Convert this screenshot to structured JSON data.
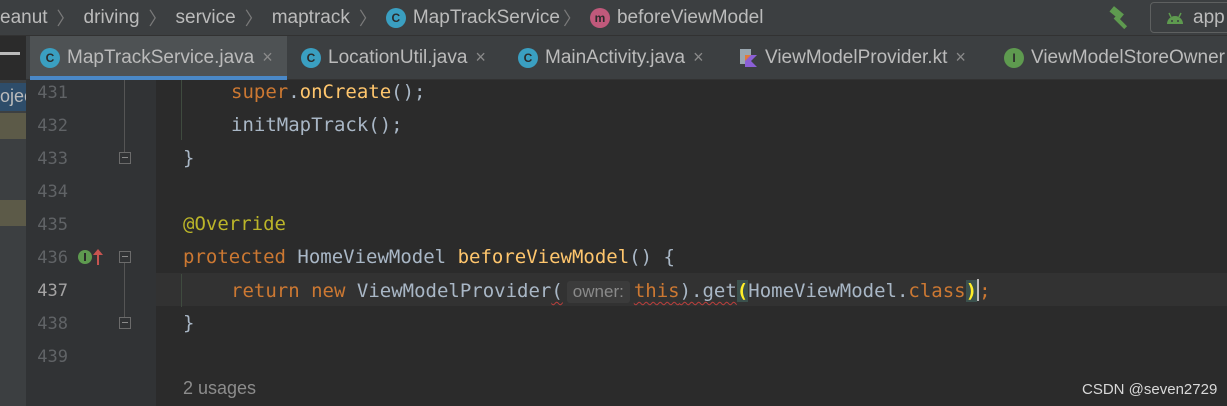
{
  "breadcrumb": {
    "items": [
      "eanut",
      "driving",
      "service",
      "maptrack"
    ],
    "class_item": {
      "icon_letter": "C",
      "label": "MapTrackService"
    },
    "method_item": {
      "icon_letter": "m",
      "label": "beforeViewModel"
    }
  },
  "run_config": {
    "label": "app"
  },
  "tabs": [
    {
      "label": "MapTrackService.java",
      "icon": "class-icon",
      "active": true,
      "closable": true
    },
    {
      "label": "LocationUtil.java",
      "icon": "class-icon",
      "active": false,
      "closable": true
    },
    {
      "label": "MainActivity.java",
      "icon": "class-icon",
      "active": false,
      "closable": true
    },
    {
      "label": "ViewModelProvider.kt",
      "icon": "kotlin-file-icon",
      "active": false,
      "closable": true
    },
    {
      "label": "ViewModelStoreOwner",
      "icon": "interface-icon",
      "active": false,
      "closable": false
    }
  ],
  "icon_letters": {
    "class": "C",
    "interface": "I"
  },
  "close_glyph": "×",
  "project_label": "ojec",
  "editor": {
    "line_numbers": [
      "431",
      "432",
      "433",
      "434",
      "435",
      "436",
      "437",
      "438",
      "439"
    ],
    "current_line": "437",
    "code": {
      "l431": {
        "a": "super",
        "b": ".",
        "c": "onCreate",
        "d": "();"
      },
      "l432": {
        "a": "initMapTrack",
        "b": "();"
      },
      "l433": "}",
      "l435": "@Override",
      "l436": {
        "kw": "protected",
        "type": "HomeViewModel",
        "name": "beforeViewModel",
        "rest": "() {"
      },
      "l437": {
        "kw1": "return",
        "kw2": "new",
        "cls": "ViewModelProvider",
        "open": "(",
        "hint": "owner:",
        "this": "this",
        "mid": ").get",
        "p": "(",
        "arg": "HomeViewModel.",
        "cls_kw": "class",
        "close": ")",
        "semi": ";"
      },
      "l438": "}"
    },
    "usages": "2 usages"
  },
  "watermark": "CSDN @seven2729",
  "colors": {
    "keyword": "#cc7832",
    "function": "#ffc66d",
    "annotation": "#bbb529",
    "text": "#a9b7c6",
    "accent": "#4a88c7"
  }
}
